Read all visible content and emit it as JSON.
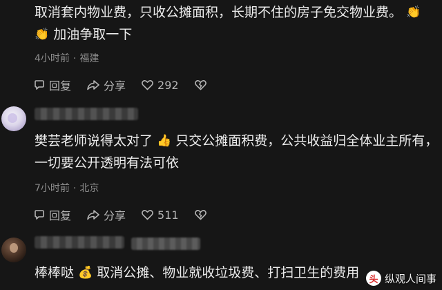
{
  "comments": [
    {
      "username": "",
      "text_before": "取消套内物业费，只收公摊面积，长期不住的房子免交物业费。",
      "emoji": [
        "👏",
        "👏"
      ],
      "text_after": "加油争取一下",
      "time": "4小时前",
      "location": "福建",
      "reply_label": "回复",
      "share_label": "分享",
      "likes": "292"
    },
    {
      "username": "",
      "text_before": "樊芸老师说得太对了",
      "emoji": [
        "👍"
      ],
      "text_after": "只交公摊面积费，公共收益归全体业主所有，一切要公开透明有法可依",
      "time": "7小时前",
      "location": "北京",
      "reply_label": "回复",
      "share_label": "分享",
      "likes": "511"
    },
    {
      "username": "",
      "text_before": "棒棒哒",
      "emoji": [
        "💰"
      ],
      "text_after": "取消公摊、物业就收垃圾费、打扫卫生的费用"
    }
  ],
  "watermark": {
    "logo_text": "头",
    "label": "纵观人间事"
  }
}
